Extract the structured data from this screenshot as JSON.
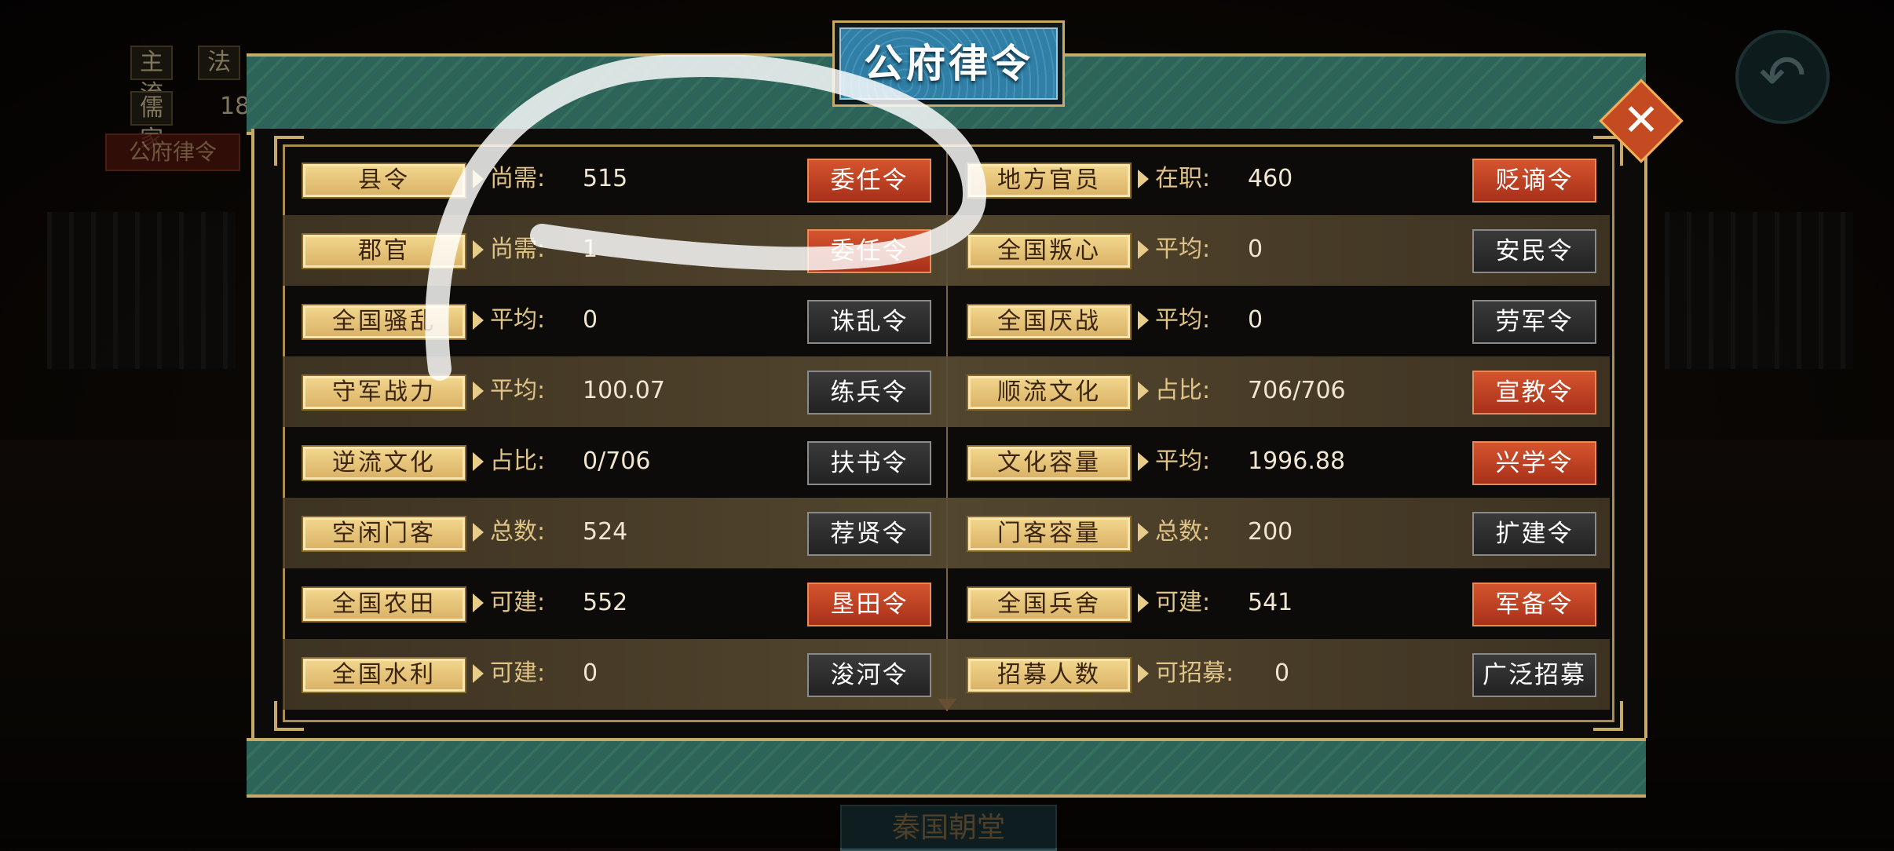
{
  "window": {
    "title": "公府律令"
  },
  "background": {
    "hud_tags": [
      "主流",
      "法",
      "儒家",
      "18"
    ],
    "law_tab": "公府律令",
    "court_title": "秦国朝堂"
  },
  "rows": [
    {
      "left": {
        "label": "县令",
        "key": "尚需:",
        "value": "515",
        "button": "委任令",
        "style": "red"
      },
      "right": {
        "label": "地方官员",
        "key": "在职:",
        "value": "460",
        "button": "贬谪令",
        "style": "red"
      }
    },
    {
      "left": {
        "label": "郡官",
        "key": "尚需:",
        "value": "1",
        "button": "委任令",
        "style": "red"
      },
      "right": {
        "label": "全国叛心",
        "key": "平均:",
        "value": "0",
        "button": "安民令",
        "style": "dark"
      }
    },
    {
      "left": {
        "label": "全国骚乱",
        "key": "平均:",
        "value": "0",
        "button": "诛乱令",
        "style": "dark"
      },
      "right": {
        "label": "全国厌战",
        "key": "平均:",
        "value": "0",
        "button": "劳军令",
        "style": "dark"
      }
    },
    {
      "left": {
        "label": "守军战力",
        "key": "平均:",
        "value": "100.07",
        "button": "练兵令",
        "style": "dark"
      },
      "right": {
        "label": "顺流文化",
        "key": "占比:",
        "value": "706/706",
        "button": "宣教令",
        "style": "red"
      }
    },
    {
      "left": {
        "label": "逆流文化",
        "key": "占比:",
        "value": "0/706",
        "button": "扶书令",
        "style": "dark"
      },
      "right": {
        "label": "文化容量",
        "key": "平均:",
        "value": "1996.88",
        "button": "兴学令",
        "style": "red"
      }
    },
    {
      "left": {
        "label": "空闲门客",
        "key": "总数:",
        "value": "524",
        "button": "荐贤令",
        "style": "dark"
      },
      "right": {
        "label": "门客容量",
        "key": "总数:",
        "value": "200",
        "button": "扩建令",
        "style": "dark"
      }
    },
    {
      "left": {
        "label": "全国农田",
        "key": "可建:",
        "value": "552",
        "button": "垦田令",
        "style": "red"
      },
      "right": {
        "label": "全国兵舍",
        "key": "可建:",
        "value": "541",
        "button": "军备令",
        "style": "red"
      }
    },
    {
      "left": {
        "label": "全国水利",
        "key": "可建:",
        "value": "0",
        "button": "浚河令",
        "style": "dark"
      },
      "right": {
        "label": "招募人数",
        "key": "可招募:",
        "value": "0",
        "button": "广泛招募",
        "style": "dark"
      }
    }
  ],
  "icons": {
    "close": "close-icon",
    "back": "back-arrow-icon"
  }
}
